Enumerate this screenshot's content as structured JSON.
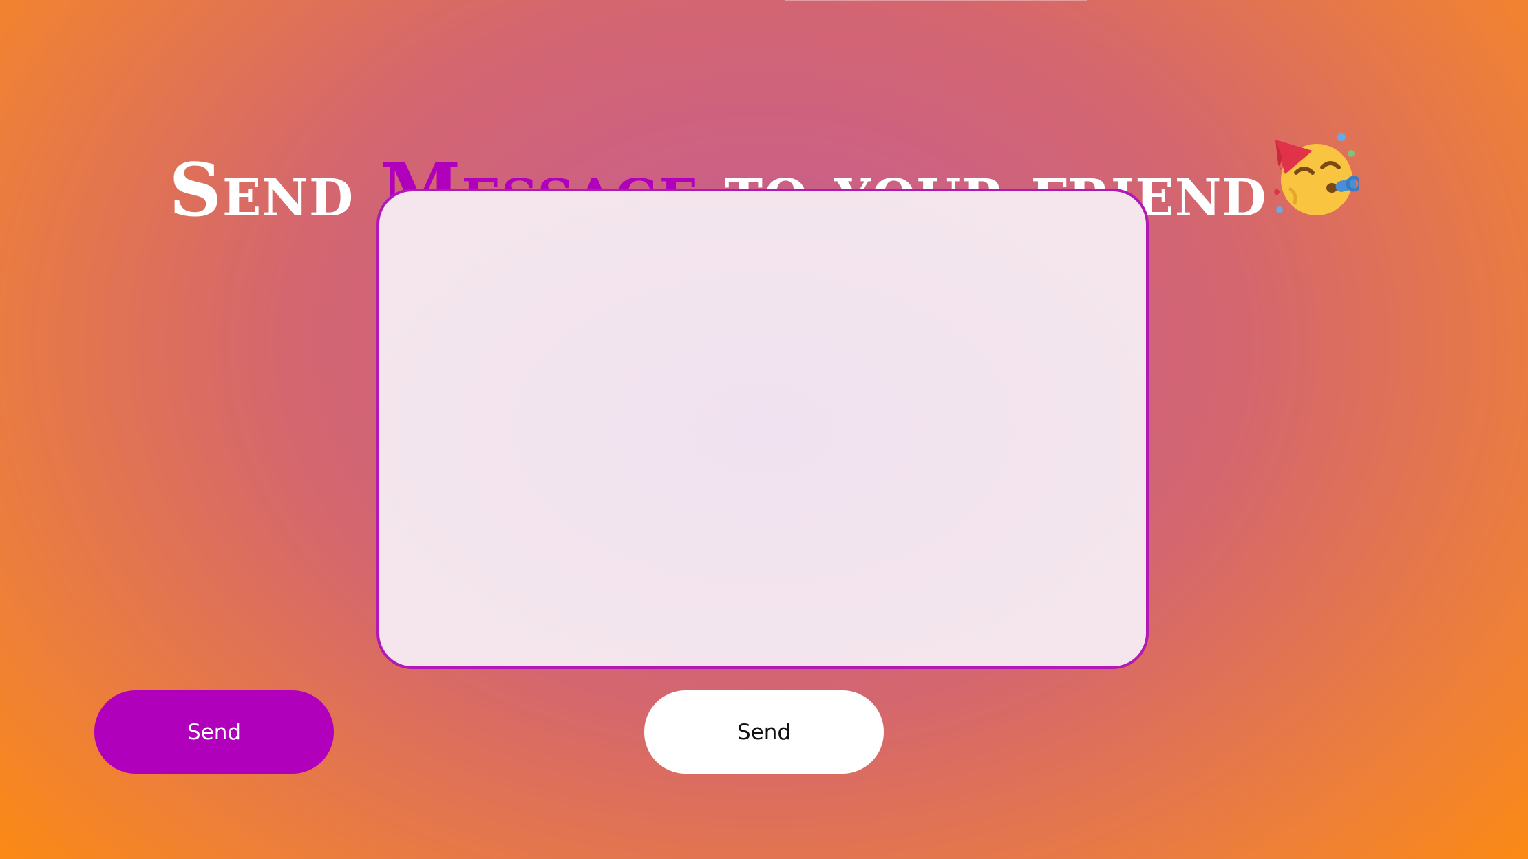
{
  "heading": {
    "part1": "Send ",
    "part2": "Message",
    "part3": " to your friend"
  },
  "emoji": {
    "icon": "party-face-icon"
  },
  "message": {
    "value": "",
    "placeholder": ""
  },
  "buttons": {
    "primary_label": "Send",
    "secondary_label": "Send"
  },
  "colors": {
    "accent": "#b000bc",
    "border": "#b019b6",
    "background_center": "#c45c98",
    "background_edge": "#ff8c0a"
  }
}
